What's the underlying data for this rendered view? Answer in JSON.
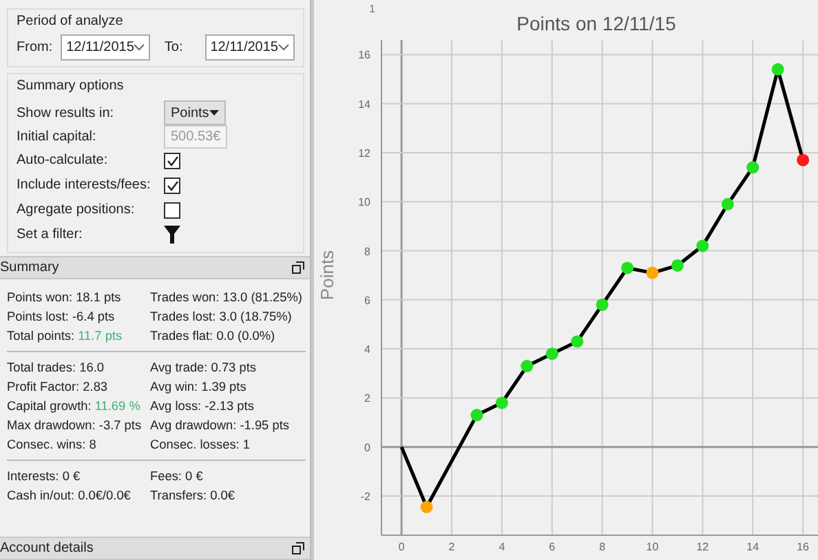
{
  "period": {
    "title": "Period of analyze",
    "from_label": "From:",
    "from_value": "12/11/2015",
    "to_label": "To:",
    "to_value": "12/11/2015"
  },
  "summary_options": {
    "title": "Summary options",
    "rows": [
      {
        "kind": "select",
        "label": "Show results in:",
        "value": "Points"
      },
      {
        "kind": "input",
        "label": "Initial capital:",
        "value": "500.53€",
        "disabled": true
      },
      {
        "kind": "checkbox",
        "label": "Auto-calculate:",
        "checked": true
      },
      {
        "kind": "checkbox",
        "label": "Include interests/fees:",
        "checked": true
      },
      {
        "kind": "checkbox",
        "label": "Agregate positions:",
        "checked": false
      },
      {
        "kind": "filter",
        "label": "Set a filter:"
      }
    ]
  },
  "summary": {
    "title": "Summary",
    "groups": [
      [
        {
          "label": "Points won:",
          "value": "18.1 pts"
        },
        {
          "label": "Trades won:",
          "value": "13.0 (81.25%)"
        },
        {
          "label": "Points lost:",
          "value": "-6.4 pts"
        },
        {
          "label": "Trades lost:",
          "value": "3.0 (18.75%)"
        },
        {
          "label": "Total points:",
          "value": "11.7 pts",
          "color": "#3cb371"
        },
        {
          "label": "Trades flat:",
          "value": "0.0 (0.0%)"
        }
      ],
      [
        {
          "label": "Total trades:",
          "value": "16.0"
        },
        {
          "label": "Avg trade:",
          "value": "0.73 pts"
        },
        {
          "label": "Profit Factor:",
          "value": "2.83"
        },
        {
          "label": "Avg win:",
          "value": "1.39 pts"
        },
        {
          "label": "Capital growth:",
          "value": "11.69 %",
          "color": "#3cb371"
        },
        {
          "label": "Avg loss:",
          "value": "-2.13 pts"
        },
        {
          "label": "Max drawdown:",
          "value": "-3.7 pts"
        },
        {
          "label": "Avg drawdown:",
          "value": "-1.95 pts"
        },
        {
          "label": "Consec. wins:",
          "value": "8"
        },
        {
          "label": "Consec. losses:",
          "value": "1"
        }
      ],
      [
        {
          "label": "Interests:",
          "value": "0 €"
        },
        {
          "label": "Fees:",
          "value": "0 €"
        },
        {
          "label": "Cash in/out:",
          "value": "0.0€/0.0€"
        },
        {
          "label": "Transfers:",
          "value": "0.0€"
        }
      ]
    ]
  },
  "account_details": {
    "title": "Account details"
  },
  "ruler_label": "1",
  "chart": {
    "chart_data": {
      "type": "line",
      "title": "Points on 12/11/15",
      "ylabel": "Points",
      "x": [
        0,
        1,
        3,
        4,
        5,
        6,
        7,
        8,
        9,
        10,
        11,
        12,
        13,
        14,
        15,
        16
      ],
      "series": [
        {
          "color": "#000000",
          "marker": "circle",
          "values": [
            0,
            -2.45,
            1.3,
            1.8,
            3.3,
            3.8,
            4.3,
            5.8,
            7.3,
            7.1,
            7.4,
            8.2,
            9.9,
            11.4,
            15.4,
            11.7
          ]
        }
      ],
      "grid": true,
      "xlim": [
        -0.8,
        16.6
      ],
      "ylim": [
        -3.6,
        16.6
      ],
      "xticks": [
        0,
        2,
        4,
        6,
        8,
        10,
        12,
        14,
        16
      ],
      "yticks": [
        -2,
        0,
        2,
        4,
        6,
        8,
        10,
        12,
        14,
        16
      ]
    }
  }
}
